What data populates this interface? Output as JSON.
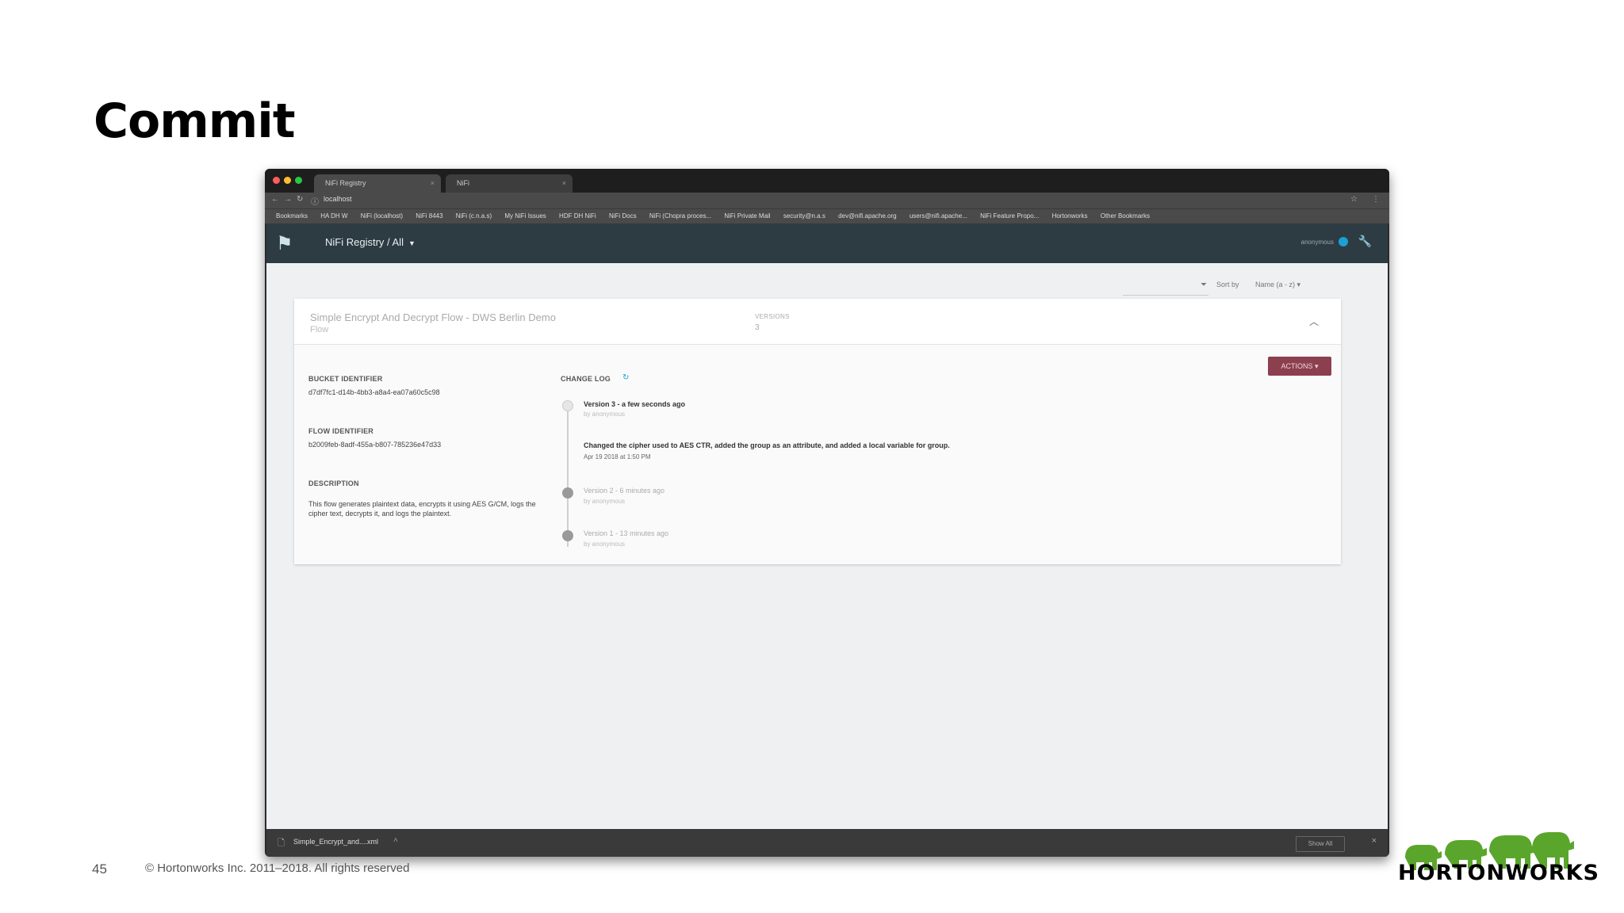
{
  "slide": {
    "title": "Commit",
    "page_number": "45",
    "copyright": "© Hortonworks Inc. 2011–2018. All rights reserved",
    "brand": "HORTONWORKS"
  },
  "browser": {
    "tabs": [
      {
        "label": "NiFi Registry",
        "close": "×"
      },
      {
        "label": "NiFi",
        "close": "×"
      }
    ],
    "url": "localhost",
    "bookmarks": [
      "Bookmarks",
      "HA DH W",
      "NiFi (localhost)",
      "NiFi 8443",
      "NiFi (c.n.a.s)",
      "My NiFi Issues",
      "HDF DH NiFi",
      "NiFi Docs",
      "NiFi (Chopra proces...",
      "NiFi Private Mail",
      "security@n.a.s",
      "dev@nifi.apache.org",
      "users@nifi.apache...",
      "NiFi Feature Propo...",
      "Hortonworks",
      "Other Bookmarks"
    ],
    "download": {
      "file": "Simple_Encrypt_and....xml",
      "show_all": "Show All",
      "close": "×"
    }
  },
  "app": {
    "title": "NiFi Registry / All",
    "user": "anonymous",
    "sort_label": "Sort by",
    "sort_value": "Name (a - z)",
    "flow": {
      "name": "Simple Encrypt And Decrypt Flow - DWS Berlin Demo",
      "type": "Flow",
      "versions_label": "VERSIONS",
      "versions_value": "3",
      "actions_label": "ACTIONS",
      "bucket_label": "BUCKET IDENTIFIER",
      "bucket_value": "d7df7fc1-d14b-4bb3-a8a4-ea07a60c5c98",
      "flow_id_label": "FLOW IDENTIFIER",
      "flow_id_value": "b2009feb-8adf-455a-b807-785236e47d33",
      "description_label": "DESCRIPTION",
      "description": "This flow generates plaintext data, encrypts it using AES G/CM, logs the cipher text, decrypts it, and logs the plaintext.",
      "changelog_label": "CHANGE LOG",
      "changelog": [
        {
          "version": "Version 3 - a few seconds ago",
          "by": "by anonymous",
          "comment": "Changed the cipher used to AES CTR, added the group as an attribute, and added a local variable for group.",
          "date": "Apr 19 2018 at 1:50 PM"
        },
        {
          "version": "Version 2 - 6 minutes ago",
          "by": "by anonymous"
        },
        {
          "version": "Version 1 - 13 minutes ago",
          "by": "by anonymous"
        }
      ]
    }
  },
  "colors": {
    "header": "#2d3b43",
    "actions": "#8c3f4f",
    "accent": "#1c9fd4",
    "elephant": "#5aa62c"
  }
}
